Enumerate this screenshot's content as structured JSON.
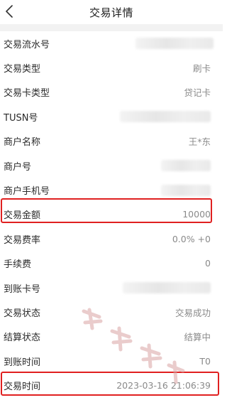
{
  "header": {
    "title": "交易详情"
  },
  "rows": [
    {
      "label": "交易流水号",
      "value": "",
      "blurred": true
    },
    {
      "label": "交易类型",
      "value": "刷卡"
    },
    {
      "label": "交易卡类型",
      "value": "贷记卡"
    },
    {
      "label": "TUSN号",
      "value": "",
      "blurred": true
    },
    {
      "label": "商户名称",
      "value": "王*东"
    },
    {
      "label": "商户号",
      "value": "",
      "blurred": true
    },
    {
      "label": "商户手机号",
      "value": "",
      "blurred": true
    },
    {
      "label": "交易金额",
      "value": "10000"
    },
    {
      "label": "交易费率",
      "value": "0.0% +0"
    },
    {
      "label": "手续费",
      "value": "0"
    },
    {
      "label": "到账卡号",
      "value": "",
      "blurred": true
    },
    {
      "label": "交易状态",
      "value": "交易成功"
    },
    {
      "label": "结算状态",
      "value": "结算中"
    },
    {
      "label": "到账时间",
      "value": "T0"
    },
    {
      "label": "交易时间",
      "value": "2023-03-16 21:06:39"
    }
  ],
  "colors": {
    "highlight": "#e02020",
    "separator": "#f2f2f2",
    "value_text": "#8a8a8a"
  },
  "icons": {
    "back": "chevron-left-icon"
  }
}
